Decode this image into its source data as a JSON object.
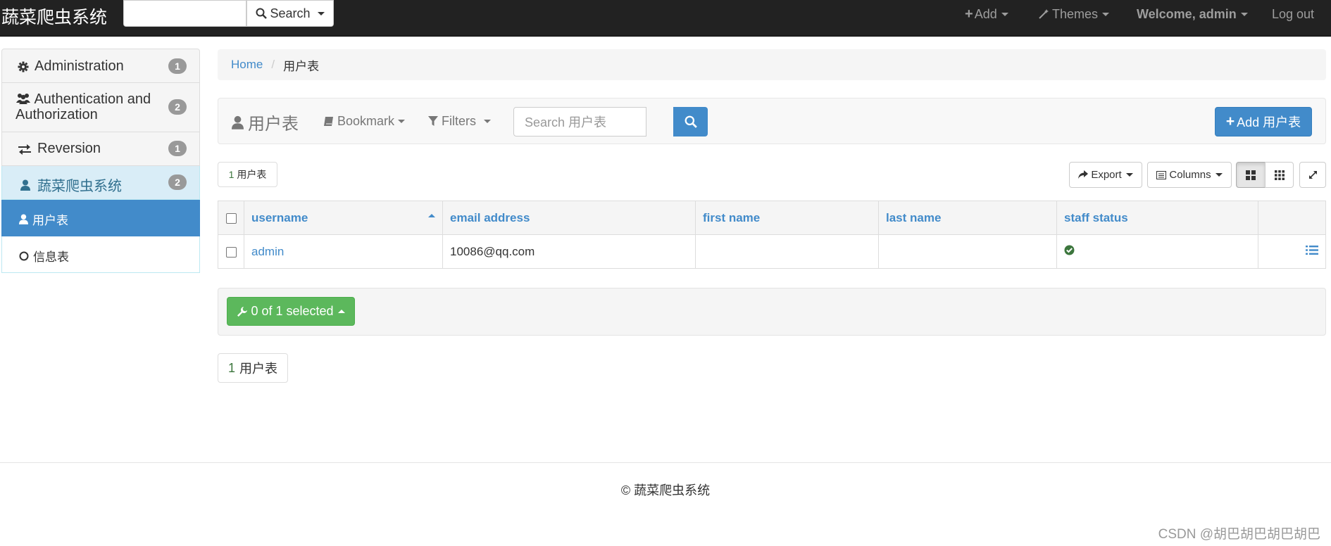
{
  "navbar": {
    "brand": "蔬菜爬虫系统",
    "search_label": "Search",
    "add_label": "Add",
    "themes_label": "Themes",
    "welcome_label": "Welcome, admin",
    "logout_label": "Log out"
  },
  "sidebar": {
    "groups": [
      {
        "label": "Administration",
        "badge": "1"
      },
      {
        "label": "Authentication and Authorization",
        "badge": "2"
      },
      {
        "label": "Reversion",
        "badge": "1"
      },
      {
        "label": "蔬菜爬虫系统",
        "badge": "2"
      }
    ],
    "sub_items": [
      {
        "label": "用户表"
      },
      {
        "label": "信息表"
      }
    ]
  },
  "breadcrumb": {
    "home": "Home",
    "current": "用户表"
  },
  "toolbar": {
    "title": "用户表",
    "bookmark_label": "Bookmark",
    "filters_label": "Filters",
    "search_placeholder": "Search 用户表",
    "add_label": "Add 用户表"
  },
  "count_box": {
    "num": "1",
    "label": "用户表"
  },
  "buttons": {
    "export_label": "Export",
    "columns_label": "Columns"
  },
  "table": {
    "columns": [
      "username",
      "email address",
      "first name",
      "last name",
      "staff status"
    ],
    "rows": [
      {
        "username": "admin",
        "email": "10086@qq.com",
        "first_name": "",
        "last_name": "",
        "staff_status": "true"
      }
    ]
  },
  "actions": {
    "label": "0 of 1 selected"
  },
  "footer": {
    "text": "© 蔬菜爬虫系统"
  },
  "watermark": "CSDN @胡巴胡巴胡巴胡巴",
  "colors": {
    "primary": "#428bca",
    "success": "#5cb85c",
    "navbar": "#222222"
  }
}
